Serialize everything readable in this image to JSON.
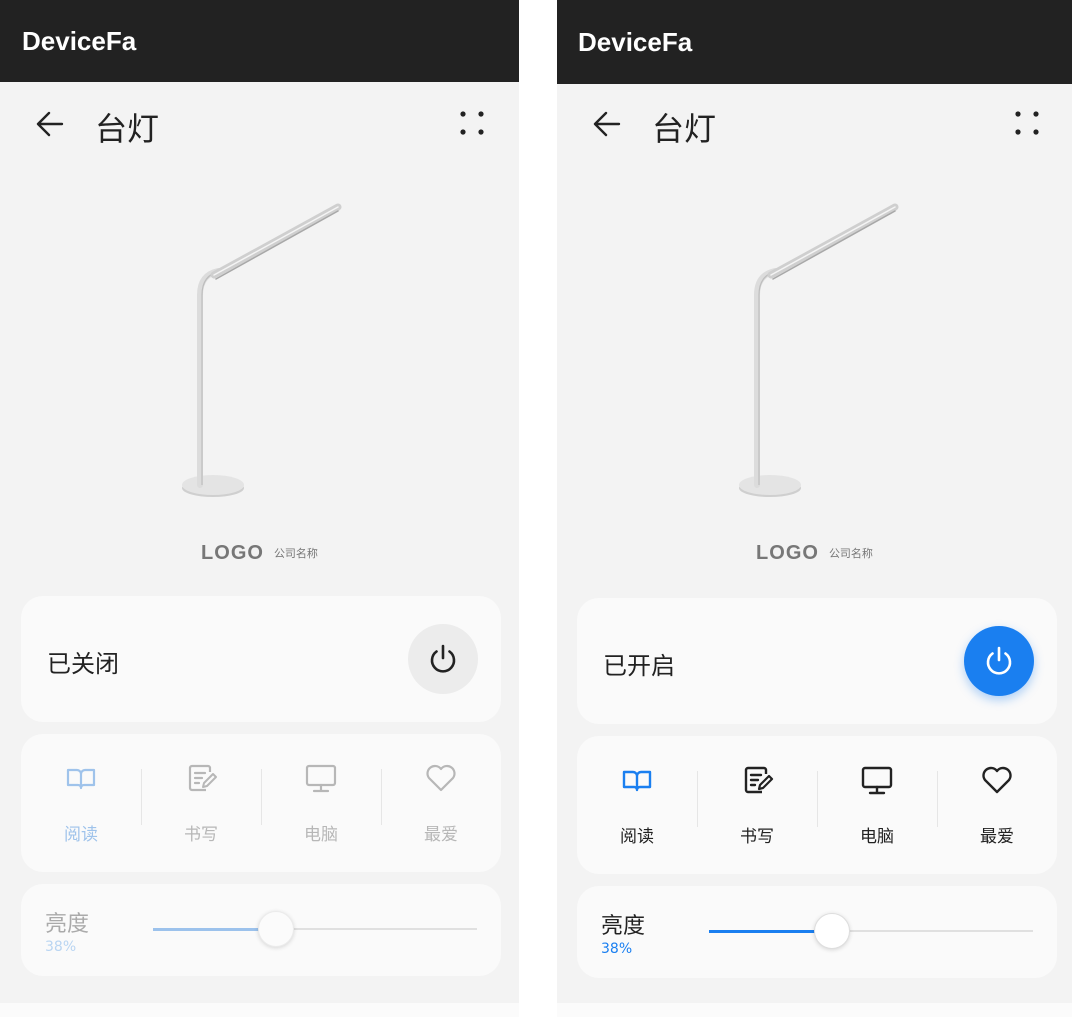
{
  "screens": [
    {
      "id": "left",
      "app_title": "DeviceFa",
      "page_title": "台灯",
      "brand": {
        "logo": "LOGO",
        "company": "公司名称"
      },
      "power": {
        "status": "已关闭",
        "state": "off"
      },
      "modes": [
        {
          "label": "阅读",
          "icon": "book-icon",
          "active": true
        },
        {
          "label": "书写",
          "icon": "edit-note-icon",
          "active": false
        },
        {
          "label": "电脑",
          "icon": "monitor-icon",
          "active": false
        },
        {
          "label": "最爱",
          "icon": "heart-icon",
          "active": false
        }
      ],
      "brightness": {
        "label": "亮度",
        "value_text": "38%",
        "level": 0.38
      }
    },
    {
      "id": "right",
      "app_title": "DeviceFa",
      "page_title": "台灯",
      "brand": {
        "logo": "LOGO",
        "company": "公司名称"
      },
      "power": {
        "status": "已开启",
        "state": "on"
      },
      "modes": [
        {
          "label": "阅读",
          "icon": "book-icon",
          "active": true
        },
        {
          "label": "书写",
          "icon": "edit-note-icon",
          "active": false
        },
        {
          "label": "电脑",
          "icon": "monitor-icon",
          "active": false
        },
        {
          "label": "最爱",
          "icon": "heart-icon",
          "active": false
        }
      ],
      "brightness": {
        "label": "亮度",
        "value_text": "38%",
        "level": 0.38
      }
    }
  ],
  "colors": {
    "accent": "#1a7ff0",
    "accent_disabled": "#9fc3eb",
    "app_bar": "#222222",
    "background": "#f3f3f3",
    "card": "#fafafa"
  }
}
